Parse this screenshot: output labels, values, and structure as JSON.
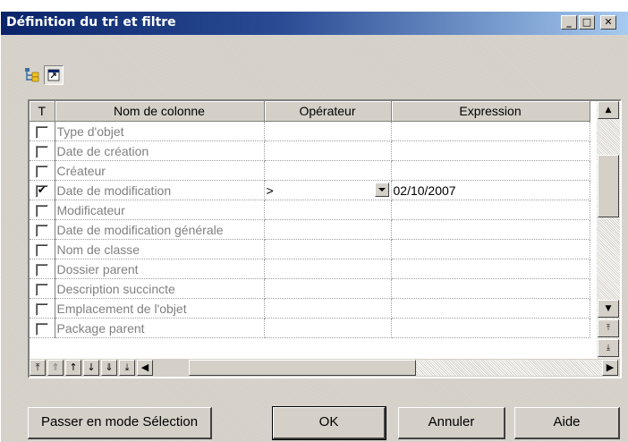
{
  "window": {
    "title": "Définition du tri et filtre"
  },
  "titlebar_buttons": {
    "minimize": "_",
    "maximize": "□",
    "close": "✕"
  },
  "toolbar": {
    "icons": [
      "tree-filter-icon",
      "dialog-icon"
    ]
  },
  "grid": {
    "headers": {
      "check": "T",
      "column": "Nom de colonne",
      "operator": "Opérateur",
      "expression": "Expression"
    },
    "rows": [
      {
        "checked": false,
        "name": "Type d'objet",
        "operator": "",
        "expression": ""
      },
      {
        "checked": false,
        "name": "Date de création",
        "operator": "",
        "expression": ""
      },
      {
        "checked": false,
        "name": "Créateur",
        "operator": "",
        "expression": ""
      },
      {
        "checked": true,
        "name": "Date de modification",
        "operator": ">",
        "expression": "02/10/2007"
      },
      {
        "checked": false,
        "name": "Modificateur",
        "operator": "",
        "expression": ""
      },
      {
        "checked": false,
        "name": "Date de modification générale",
        "operator": "",
        "expression": ""
      },
      {
        "checked": false,
        "name": "Nom de classe",
        "operator": "",
        "expression": ""
      },
      {
        "checked": false,
        "name": "Dossier parent",
        "operator": "",
        "expression": ""
      },
      {
        "checked": false,
        "name": "Description succincte",
        "operator": "",
        "expression": ""
      },
      {
        "checked": false,
        "name": "Emplacement de l'objet",
        "operator": "",
        "expression": ""
      },
      {
        "checked": false,
        "name": "Package parent",
        "operator": "",
        "expression": ""
      }
    ]
  },
  "buttons": {
    "selection_mode": "Passer en mode Sélection",
    "ok": "OK",
    "cancel": "Annuler",
    "help": "Aide"
  }
}
